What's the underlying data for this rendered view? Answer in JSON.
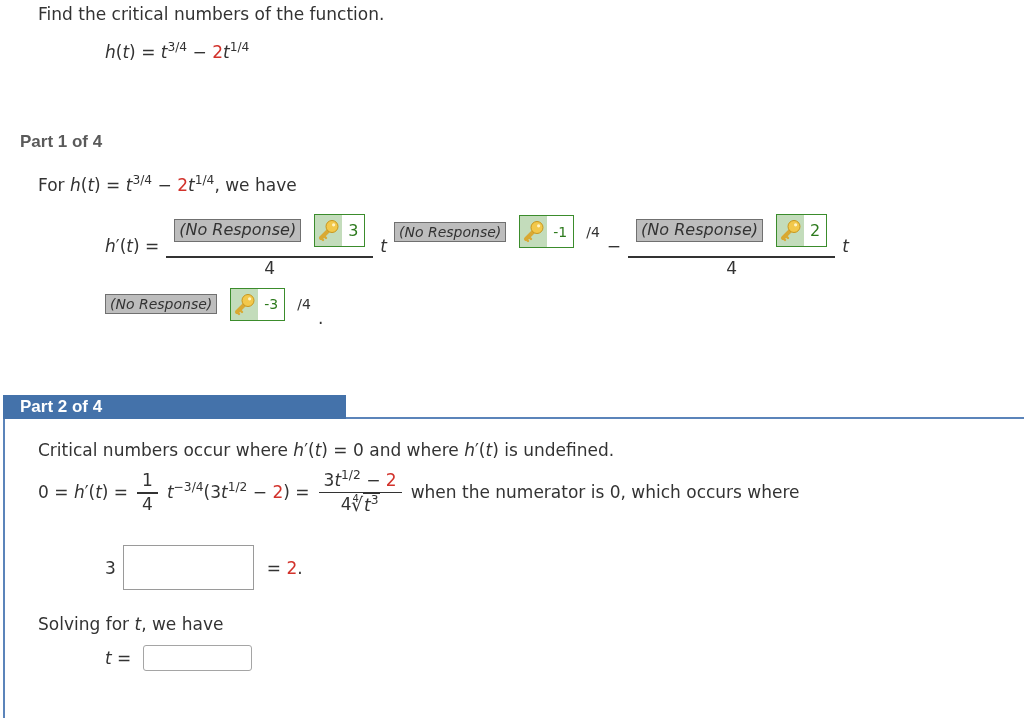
{
  "question": {
    "lines": [
      {
        "kind": "text",
        "items": [
          {
            "kind": "text",
            "text": "Find the critical numbers of the function."
          }
        ]
      },
      {
        "kind": "display",
        "items": [
          {
            "kind": "text",
            "segments": [
              {
                "text": "*h*(*t*) = *t*$^{3/4}$ − ",
                "highlight": false
              },
              {
                "text": "2",
                "highlight": true
              },
              {
                "text": "*t*$^{1/4}$",
                "highlight": false
              }
            ]
          }
        ]
      }
    ]
  },
  "parts": [
    {
      "title": "Part 1 of 4",
      "current": false,
      "lines": [
        {
          "kind": "text",
          "items": [
            {
              "kind": "text",
              "segments": [
                {
                  "text": "For *h*(*t*) = *t*$^{3/4}$ − ",
                  "highlight": false
                },
                {
                  "text": "2",
                  "highlight": true
                },
                {
                  "text": "*t*$^{1/4}$, we have",
                  "highlight": false
                }
              ]
            }
          ]
        },
        {
          "kind": "display",
          "items": [
            {
              "kind": "text",
              "text": "*h*′(*t*) ="
            },
            {
              "kind": "fraction",
              "numerator": [
                {
                  "kind": "response",
                  "response": "(No Response)",
                  "answer": "3"
                }
              ],
              "denominator": [
                {
                  "kind": "text",
                  "text": "4"
                }
              ]
            },
            {
              "kind": "text",
              "text": "*t*"
            },
            {
              "kind": "raised",
              "items": [
                {
                  "kind": "response",
                  "response": "(No Response)",
                  "answer": "-1"
                },
                {
                  "kind": "text",
                  "text": "/4"
                }
              ]
            },
            {
              "kind": "text",
              "text": "−"
            },
            {
              "kind": "fraction",
              "numerator": [
                {
                  "kind": "response",
                  "response": "(No Response)",
                  "answer": "2"
                }
              ],
              "denominator": [
                {
                  "kind": "text",
                  "text": "4"
                }
              ]
            },
            {
              "kind": "text",
              "text": "*t*"
            }
          ]
        },
        {
          "kind": "display",
          "items": [
            {
              "kind": "raised",
              "items": [
                {
                  "kind": "response",
                  "response": "(No Response)",
                  "answer": "-3"
                },
                {
                  "kind": "text",
                  "text": "/4"
                }
              ]
            },
            {
              "kind": "text",
              "text": "."
            }
          ]
        }
      ]
    },
    {
      "title": "Part 2 of 4",
      "current": true,
      "lines": [
        {
          "kind": "text",
          "items": [
            {
              "kind": "text",
              "text": "Critical numbers occur where *h*′(*t*) = 0 and where *h*′(*t*) is undefined."
            }
          ]
        },
        {
          "kind": "text",
          "items": [
            {
              "kind": "text",
              "text": "0 = *h*′(*t*) ="
            },
            {
              "kind": "fraction",
              "numerator": [
                {
                  "kind": "text",
                  "text": "1"
                }
              ],
              "denominator": [
                {
                  "kind": "text",
                  "text": "4"
                }
              ]
            },
            {
              "kind": "text",
              "segments": [
                {
                  "text": "*t*$^{−3/4}$(3",
                  "highlight": false
                },
                {
                  "text": "*t*$^{1/2}$ − ",
                  "highlight": false
                },
                {
                  "text": "2",
                  "highlight": true
                },
                {
                  "text": ") =",
                  "highlight": false
                }
              ]
            },
            {
              "kind": "fraction",
              "numerator": [
                {
                  "kind": "text",
                  "segments": [
                    {
                      "text": "3",
                      "highlight": false
                    },
                    {
                      "text": "*t*$^{1/2}$ − ",
                      "highlight": false
                    },
                    {
                      "text": "2",
                      "highlight": true
                    }
                  ]
                }
              ],
              "denominator": [
                {
                  "kind": "text",
                  "text": "4"
                },
                {
                  "kind": "root",
                  "index": "4",
                  "sign": "√",
                  "radicand": "*t*$^{3}$"
                }
              ]
            },
            {
              "kind": "text",
              "text": "when the numerator is 0, which occurs where"
            }
          ]
        },
        {
          "kind": "display",
          "items": [
            {
              "kind": "text",
              "text": "3"
            },
            {
              "kind": "mathinput"
            },
            {
              "kind": "text",
              "segments": [
                {
                  "text": "= ",
                  "highlight": false
                },
                {
                  "text": "2",
                  "highlight": true
                },
                {
                  "text": ".",
                  "highlight": false
                }
              ]
            }
          ]
        },
        {
          "kind": "text",
          "items": [
            {
              "kind": "text",
              "text": "Solving for *t*, we have"
            }
          ]
        },
        {
          "kind": "display",
          "items": [
            {
              "kind": "text",
              "text": "*t* ="
            },
            {
              "kind": "input"
            }
          ]
        }
      ]
    }
  ]
}
